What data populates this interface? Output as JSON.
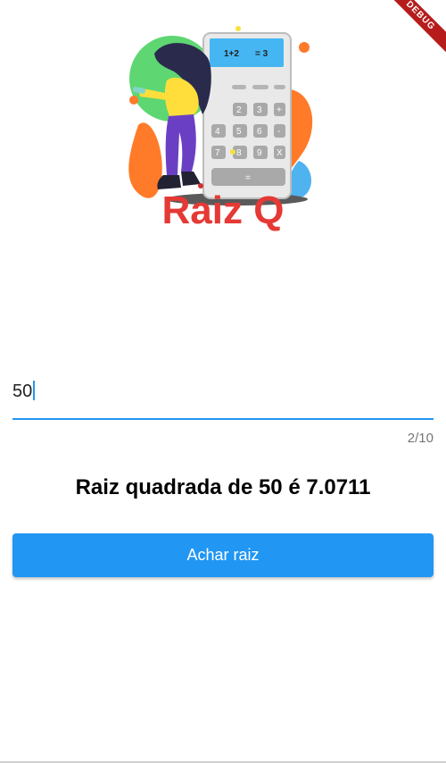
{
  "app": {
    "title": "Raiz Q",
    "debug_banner": "DEBUG"
  },
  "illustration": {
    "display_expression": "1+2",
    "display_result": "= 3",
    "keys": [
      "2",
      "3",
      "+",
      "4",
      "5",
      "6",
      "-",
      "7",
      "8",
      "9",
      "X",
      "="
    ]
  },
  "input": {
    "value": "50",
    "counter": "2/10"
  },
  "result": {
    "text": "Raiz quadrada de 50 é 7.0711"
  },
  "button": {
    "label": "Achar raiz"
  },
  "colors": {
    "accent": "#2196f3",
    "title": "#e53935"
  }
}
